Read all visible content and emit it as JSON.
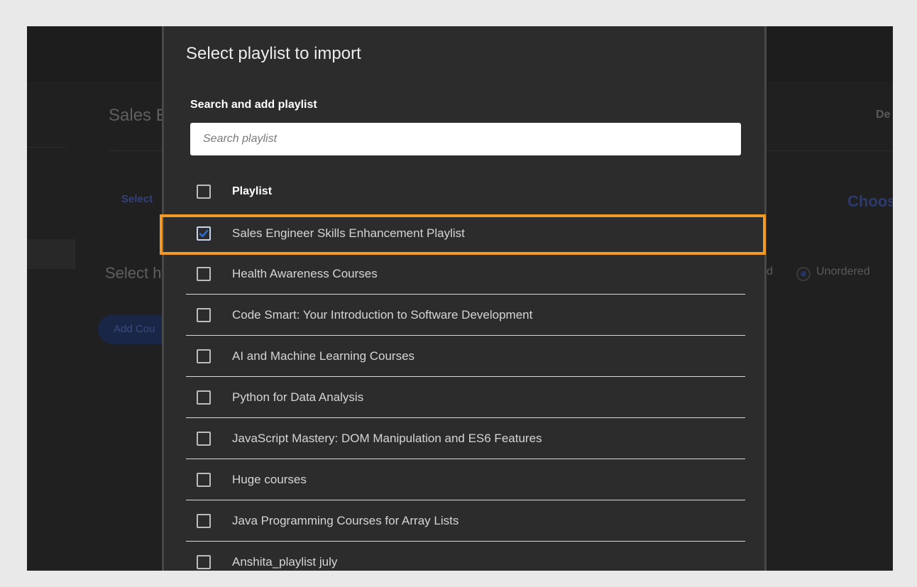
{
  "background": {
    "title_fragment": "Sales E",
    "select_fragment_small": "Select",
    "select_fragment_large": "Select h",
    "add_button_fragment": "Add Cou",
    "top_right_fragment": "De",
    "choose_fragment": "Choos",
    "ordered_fragment": "d",
    "unordered_label": "Unordered"
  },
  "modal": {
    "title": "Select playlist to import",
    "search_label": "Search and add playlist",
    "search_placeholder": "Search playlist",
    "search_value": "",
    "header_label": "Playlist",
    "items": [
      {
        "label": "Sales Engineer Skills Enhancement Playlist",
        "checked": true
      },
      {
        "label": "Health Awareness Courses",
        "checked": false
      },
      {
        "label": "Code Smart: Your Introduction to Software Development",
        "checked": false
      },
      {
        "label": "AI and Machine Learning Courses",
        "checked": false
      },
      {
        "label": "Python for Data Analysis",
        "checked": false
      },
      {
        "label": "JavaScript Mastery: DOM Manipulation and ES6 Features",
        "checked": false
      },
      {
        "label": "Huge courses",
        "checked": false
      },
      {
        "label": "Java Programming Courses for Array Lists",
        "checked": false
      },
      {
        "label": "Anshita_playlist july",
        "checked": false
      }
    ]
  },
  "colors": {
    "highlight": "#f39a26",
    "modal_bg": "#2c2c2c",
    "checkbox_check": "#2f6fd8"
  }
}
